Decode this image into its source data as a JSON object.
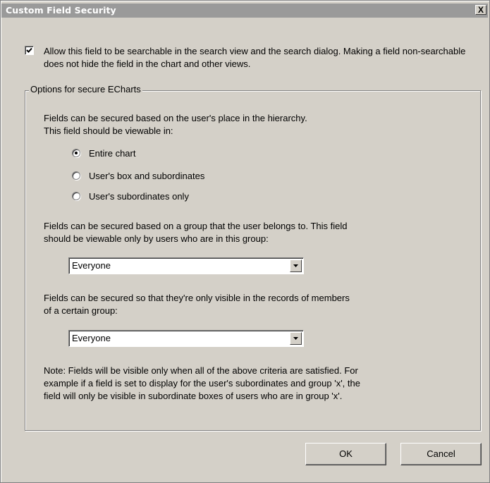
{
  "window": {
    "title": "Custom Field Security",
    "close_label": "X"
  },
  "searchable": {
    "checked": true,
    "label": "Allow this field to be searchable in the search view and the search dialog. Making a field non-searchable does not hide the field in the chart and other views."
  },
  "options_group": {
    "legend": "Options for secure ECharts",
    "hierarchy_text_line1": "Fields can be secured based on the user's place in the hierarchy.",
    "hierarchy_text_line2": "This field should be viewable in:",
    "radios": [
      {
        "label": "Entire chart",
        "selected": true
      },
      {
        "label": "User's box and subordinates",
        "selected": false
      },
      {
        "label": "User's subordinates only",
        "selected": false
      }
    ],
    "group_text_line1": "Fields can be secured based on a group that the user belongs to. This field",
    "group_text_line2": "should be viewable only by users who are in this group:",
    "group_select_value": "Everyone",
    "records_text_line1": "Fields can be secured so that they're only visible in the records of members",
    "records_text_line2": "of a certain group:",
    "records_select_value": "Everyone",
    "note_line1": "Note: Fields will be visible only when all of the above criteria are satisfied. For",
    "note_line2": "example if a field is set to display for the user's subordinates and group 'x', the",
    "note_line3": "field will only be visible in subordinate boxes of users who are in group 'x'."
  },
  "buttons": {
    "ok": "OK",
    "cancel": "Cancel"
  }
}
